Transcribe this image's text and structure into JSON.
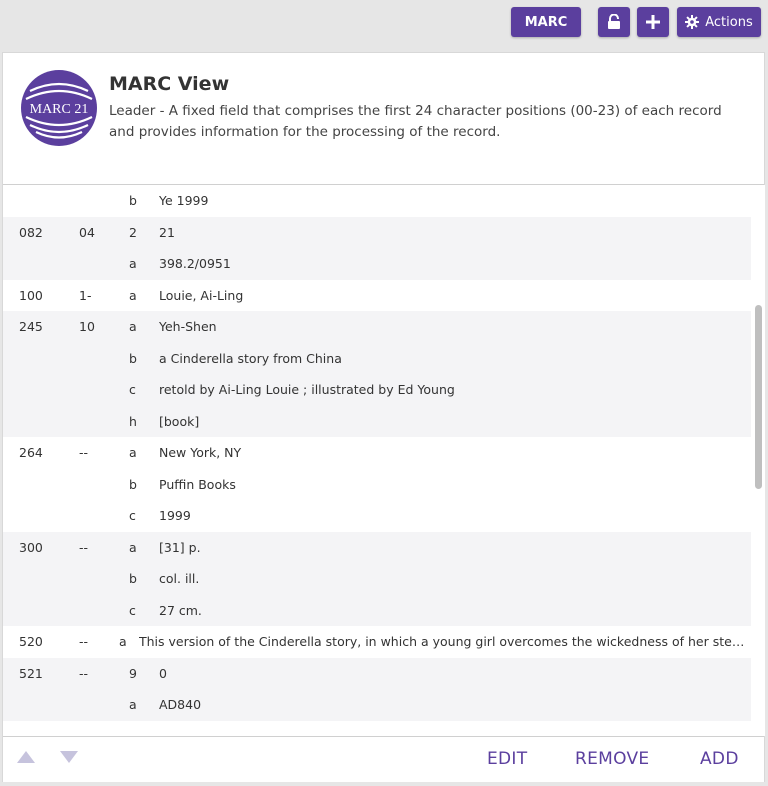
{
  "toolbar": {
    "marc_label": "MARC",
    "actions_label": "Actions"
  },
  "header": {
    "logo_text": "MARC 21",
    "title": "MARC View",
    "description": "Leader - A fixed field that comprises the first 24 character positions (00-23) of each record and provides information for the processing of the record."
  },
  "records": [
    {
      "tag": "",
      "ind": "",
      "shaded": false,
      "subfields": [
        {
          "code": "b",
          "value": "Ye 1999"
        }
      ]
    },
    {
      "tag": "082",
      "ind": "04",
      "shaded": true,
      "subfields": [
        {
          "code": "2",
          "value": "21"
        },
        {
          "code": "a",
          "value": "398.2/0951"
        }
      ]
    },
    {
      "tag": "100",
      "ind": "1-",
      "shaded": false,
      "subfields": [
        {
          "code": "a",
          "value": "Louie, Ai-Ling"
        }
      ]
    },
    {
      "tag": "245",
      "ind": "10",
      "shaded": true,
      "subfields": [
        {
          "code": "a",
          "value": "Yeh-Shen"
        },
        {
          "code": "b",
          "value": "a Cinderella story from China"
        },
        {
          "code": "c",
          "value": "retold by Ai-Ling Louie ; illustrated by Ed Young"
        },
        {
          "code": "h",
          "value": "[book]"
        }
      ]
    },
    {
      "tag": "264",
      "ind": "--",
      "shaded": false,
      "subfields": [
        {
          "code": "a",
          "value": "New York, NY"
        },
        {
          "code": "b",
          "value": "Puffin Books"
        },
        {
          "code": "c",
          "value": "1999"
        }
      ]
    },
    {
      "tag": "300",
      "ind": "--",
      "shaded": true,
      "subfields": [
        {
          "code": "a",
          "value": "[31] p."
        },
        {
          "code": "b",
          "value": "col. ill."
        },
        {
          "code": "c",
          "value": "27 cm."
        }
      ]
    },
    {
      "tag": "520",
      "ind": "--",
      "shaded": false,
      "long": true,
      "subfields": [
        {
          "code": "a",
          "value": "This version of the Cinderella story, in which a young girl overcomes the wickedness of her stepsister and..."
        }
      ]
    },
    {
      "tag": "521",
      "ind": "--",
      "shaded": true,
      "subfields": [
        {
          "code": "9",
          "value": "0"
        },
        {
          "code": "a",
          "value": "AD840"
        }
      ]
    }
  ],
  "footer": {
    "edit_label": "EDIT",
    "remove_label": "REMOVE",
    "add_label": "ADD"
  },
  "colors": {
    "accent": "#5b3f9e",
    "arrow_disabled": "#c6c3dd",
    "row_shade": "#f4f4f6"
  }
}
